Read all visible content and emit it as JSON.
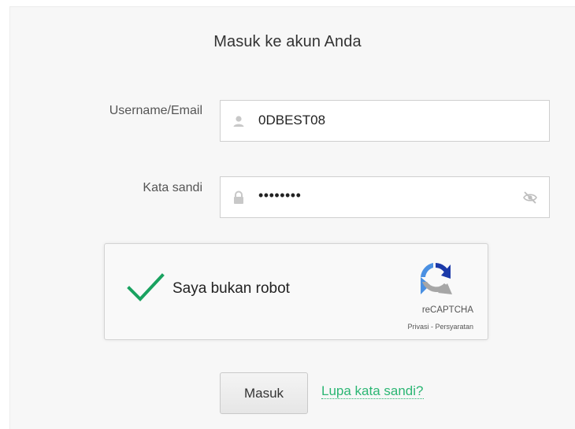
{
  "form": {
    "title": "Masuk ke akun Anda",
    "username_label": "Username/Email",
    "username_value": "0DBEST08",
    "password_label": "Kata sandi",
    "password_value": "••••••••",
    "submit_label": "Masuk",
    "forgot_label": "Lupa kata sandi?"
  },
  "captcha": {
    "label": "Saya bukan robot",
    "brand": "reCAPTCHA",
    "privacy": "Privasi",
    "separator": " - ",
    "terms": "Persyaratan",
    "checked": true
  },
  "icons": {
    "user": "user-icon",
    "lock": "lock-icon",
    "eye": "eye-slash-icon",
    "check": "checkmark-icon",
    "recaptcha": "recaptcha-logo-icon"
  },
  "colors": {
    "accent_green": "#2bb673",
    "check_green": "#1aa260"
  }
}
